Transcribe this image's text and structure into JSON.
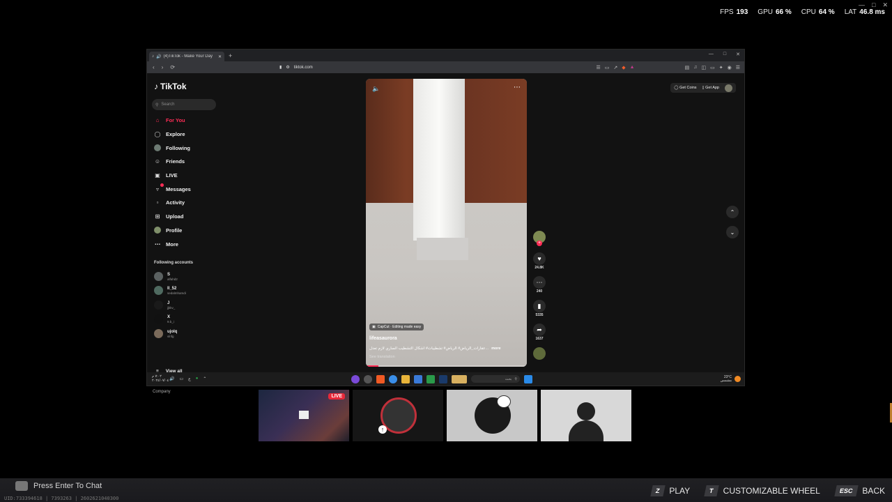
{
  "hud": {
    "fps_label": "FPS",
    "fps": "193",
    "gpu_label": "GPU",
    "gpu": "66 %",
    "cpu_label": "CPU",
    "cpu": "64 %",
    "lat_label": "LAT",
    "lat": "46.8 ms"
  },
  "browser": {
    "tab_title": "(4)TikTok - Make Your Day",
    "url": "tiktok.com"
  },
  "tiktok": {
    "logo": "TikTok",
    "search_placeholder": "Search",
    "nav": [
      {
        "label": "For You",
        "icon": "home-icon"
      },
      {
        "label": "Explore",
        "icon": "compass-icon"
      },
      {
        "label": "Following",
        "icon": "following-avatar-icon"
      },
      {
        "label": "Friends",
        "icon": "friends-icon"
      },
      {
        "label": "LIVE",
        "icon": "live-icon"
      },
      {
        "label": "Messages",
        "icon": "messages-icon"
      },
      {
        "label": "Activity",
        "icon": "activity-icon"
      },
      {
        "label": "Upload",
        "icon": "upload-icon"
      },
      {
        "label": "Profile",
        "icon": "profile-icon"
      },
      {
        "label": "More",
        "icon": "more-icon"
      }
    ],
    "following_title": "Following accounts",
    "accounts": [
      {
        "name": "S",
        "handle": "alfahd2"
      },
      {
        "name": "ll_52",
        "handle": "sedalmhamdi"
      },
      {
        "name": "J",
        "handle": "jjkkv_"
      },
      {
        "name": "X",
        "handle": "9.b_i"
      },
      {
        "name": "ujolq",
        "handle": "vlnfg"
      }
    ],
    "view_all": "View all",
    "company": "Company",
    "get_coins": "Get Coins",
    "get_app": "Get App"
  },
  "video": {
    "capcut": "CapCut · Editing made easy",
    "username": "lifeasaurora",
    "description": "عقارات_الرياض# الرياض# تشطيبات# اشكال التشطيب الساري لازم تعدل...",
    "more": "more",
    "see_translation": "See translation",
    "progress": 0.08,
    "likes": "24.8K",
    "comments": "240",
    "saves": "5335",
    "shares": "1637"
  },
  "taskbar": {
    "time": "٧:٠٢ م",
    "date": "٢٠٢٤/٠٧/٠٤",
    "search_placeholder": "بحث",
    "temp": "23°C",
    "weather": "مشمس"
  },
  "stream": {
    "live_badge": "LIVE"
  },
  "bottom": {
    "chat_prompt": "Press Enter To Chat",
    "meta": "UID:733394618 | 7393263 | 2602621040300",
    "play_key": "Z",
    "play_label": "PLAY",
    "wheel_key": "T",
    "wheel_label": "CUSTOMIZABLE WHEEL",
    "back_key": "ESC",
    "back_label": "BACK"
  }
}
